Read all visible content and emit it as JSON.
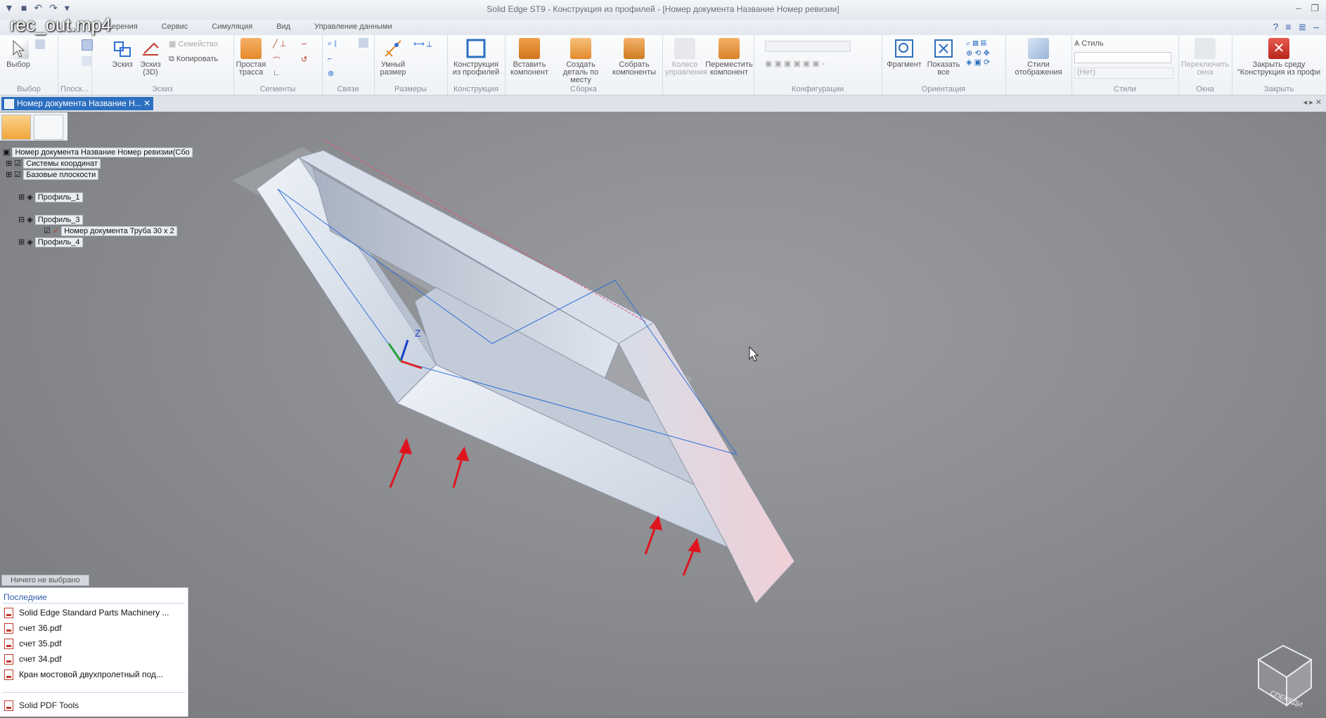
{
  "window": {
    "title": "Solid Edge ST9 - Конструкция из профилей - [Номер документа Название Номер ревизии]",
    "video_overlay": "rec_out.mp4"
  },
  "menu": {
    "tabs": [
      "...ерения",
      "Сервис",
      "Симуляция",
      "Вид",
      "Управление данными"
    ]
  },
  "ribbon": {
    "groups": {
      "select": {
        "label": "Выбор",
        "buttons": [
          "Выбор"
        ]
      },
      "planes": {
        "label": "Плоск..."
      },
      "sketch": {
        "label": "Эскиз",
        "buttons": [
          "Эскиз",
          "Эскиз (3D)"
        ],
        "small": [
          "Семейство",
          "Копировать"
        ]
      },
      "segments": {
        "label": "Сегменты",
        "buttons": [
          "Простая трасса"
        ]
      },
      "links": {
        "label": "Связи"
      },
      "dims": {
        "label": "Размеры",
        "buttons": [
          "Умный размер"
        ]
      },
      "construction": {
        "label": "Конструкция",
        "buttons": [
          "Конструкция из профилей"
        ]
      },
      "assembly": {
        "label": "Сборка",
        "buttons": [
          "Вставить компонент",
          "Создать деталь по месту",
          "Собрать компоненты"
        ]
      },
      "move": {
        "buttons": [
          "Колесо управления",
          "Переместить компонент"
        ]
      },
      "configs": {
        "label": "Конфигурации"
      },
      "orientation": {
        "label": "Ориентация",
        "buttons": [
          "Фрагмент",
          "Показать все"
        ]
      },
      "display": {
        "buttons": [
          "Стили отображения"
        ]
      },
      "styles": {
        "label": "Стили",
        "style_label": "Стиль",
        "style_value": "(Нет)"
      },
      "windows": {
        "label": "Окна",
        "buttons": [
          "Переключить окна"
        ]
      },
      "close": {
        "label": "Закрыть",
        "buttons": [
          "Закрыть среду \"Конструкция из профи"
        ]
      }
    }
  },
  "document_tab": {
    "label": "Номер документа Название Н..."
  },
  "tree": {
    "root": "Номер документа Название Номер ревизии(Сбо",
    "items": [
      "Системы координат",
      "Базовые плоскости",
      "Профиль_1",
      "Профиль_3",
      "Номер документа Труба 30 х 2",
      "Профиль_4"
    ]
  },
  "status": "Ничего не выбрано",
  "recent": {
    "header": "Последние",
    "items": [
      "Solid Edge Standard Parts Machinery ...",
      "счет 36.pdf",
      "счет 35.pdf",
      "счет 34.pdf",
      "Кран мостовой двухпролетный под..."
    ],
    "tools": "Solid PDF Tools"
  },
  "viewcube": {
    "label": "СПЕРЕДИ"
  },
  "triad": {
    "z": "Z"
  },
  "colors": {
    "accent": "#2c6fc0",
    "arrow": "#e0141e",
    "sketch_blue": "#2f6fd6",
    "sketch_red": "#e8506e"
  }
}
